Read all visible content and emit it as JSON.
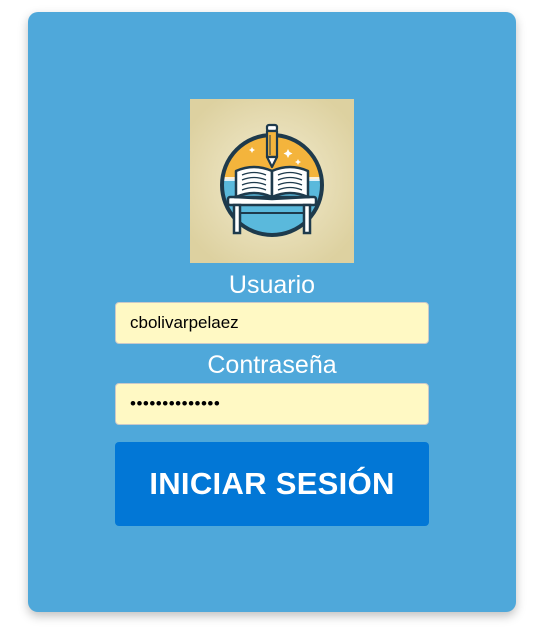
{
  "logo": {
    "icon": "book-on-desk-with-pencil-icon",
    "colors": {
      "background": "#e6dcae",
      "circle_top": "#f4b43c",
      "circle_bottom": "#5ab9dc",
      "outline": "#1e3a4c"
    }
  },
  "login": {
    "username_label": "Usuario",
    "username_value": "cbolivarpelaez",
    "password_label": "Contraseña",
    "password_value": "••••••••••••••",
    "submit_label": "INICIAR SESIÓN"
  },
  "colors": {
    "card": "#4fa8da",
    "field": "#fff9c4",
    "button": "#0277d6"
  }
}
